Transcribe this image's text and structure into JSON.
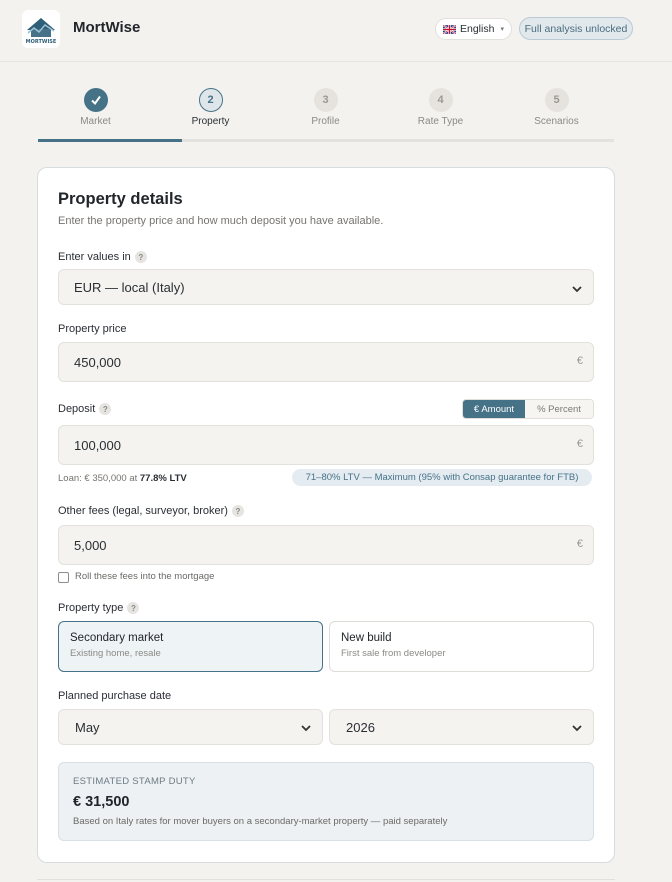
{
  "header": {
    "brand": "MortWise",
    "logo_text": "MORTWISE",
    "language": "English",
    "status_pill": "Full analysis unlocked"
  },
  "steps": [
    {
      "number": "1",
      "label": "Market",
      "state": "done"
    },
    {
      "number": "2",
      "label": "Property",
      "state": "current"
    },
    {
      "number": "3",
      "label": "Profile",
      "state": "todo"
    },
    {
      "number": "4",
      "label": "Rate Type",
      "state": "todo"
    },
    {
      "number": "5",
      "label": "Scenarios",
      "state": "todo"
    }
  ],
  "progress_fraction": 0.25,
  "card": {
    "title": "Property details",
    "subtitle": "Enter the property price and how much deposit you have available.",
    "currency_label": "Enter values in",
    "currency_value": "EUR — local (Italy)",
    "price_label": "Property price",
    "price_value": "450,000",
    "currency_symbol": "€",
    "deposit_label": "Deposit",
    "deposit_toggle_amount": "€ Amount",
    "deposit_toggle_percent": "% Percent",
    "deposit_value": "100,000",
    "loan_prefix": "Loan: € 350,000 at ",
    "loan_ltv": "77.8% LTV",
    "ltv_note": "71–80% LTV — Maximum (95% with Consap guarantee for FTB)",
    "fees_label": "Other fees (legal, surveyor, broker)",
    "fees_value": "5,000",
    "roll_fees_label": "Roll these fees into the mortgage",
    "roll_fees_checked": false,
    "property_type_label": "Property type",
    "property_types": [
      {
        "title": "Secondary market",
        "subtitle": "Existing home, resale",
        "selected": true
      },
      {
        "title": "New build",
        "subtitle": "First sale from developer",
        "selected": false
      }
    ],
    "purchase_date_label": "Planned purchase date",
    "purchase_month": "May",
    "purchase_year": "2026",
    "stamp_duty_label": "ESTIMATED STAMP DUTY",
    "stamp_duty_value": "€ 31,500",
    "stamp_duty_note": "Based on Italy rates for mover buyers on a secondary-market property — paid separately"
  },
  "colors": {
    "accent": "#467287",
    "background": "#f3f2ef",
    "card": "#ffffff"
  }
}
